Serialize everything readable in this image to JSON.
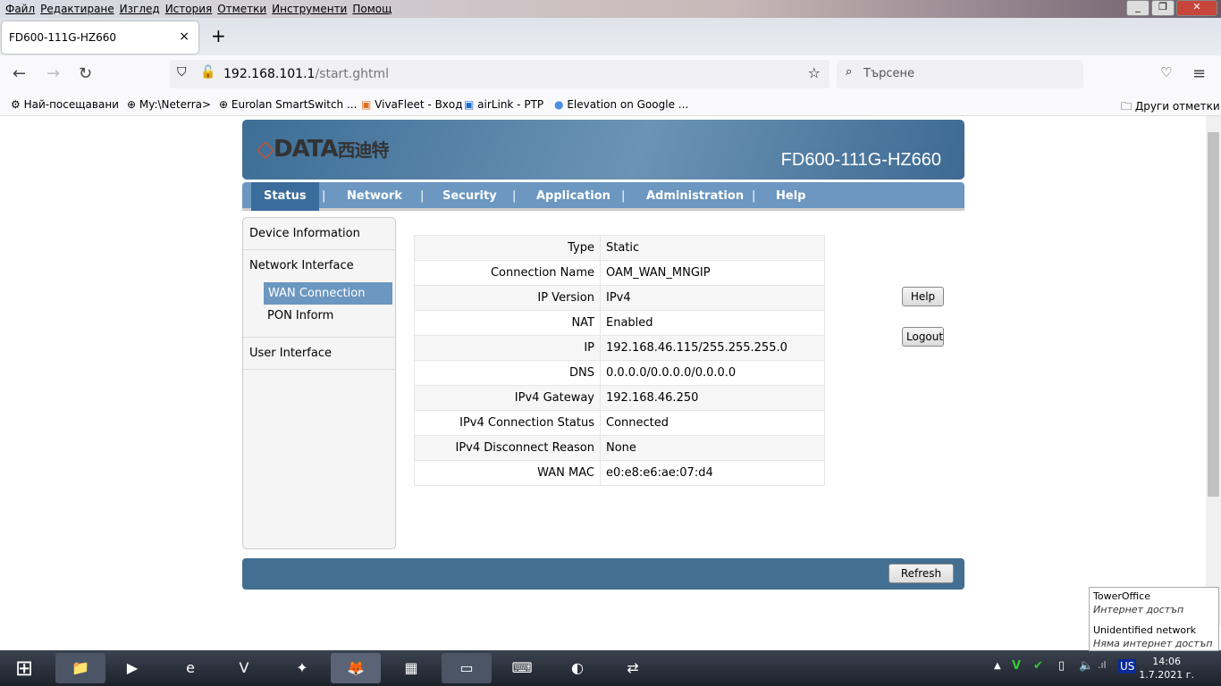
{
  "browser": {
    "menu": [
      "Файл",
      "Редактиране",
      "Изглед",
      "История",
      "Отметки",
      "Инструменти",
      "Помощ"
    ],
    "tab_title": "FD600-111G-HZ660",
    "url_host": "192.168.101.1",
    "url_path": "/start.ghtml",
    "search_placeholder": "Търсене",
    "bookmarks": [
      "Най-посещавани",
      "My:\\Neterra>",
      "Eurolan SmartSwitch ...",
      "VivaFleet - Вход",
      "airLink - PTP",
      "Elevation on Google ..."
    ],
    "other_bookmarks": "Други отметки"
  },
  "header": {
    "logo": "DATA西迪特",
    "model": "FD600-111G-HZ660"
  },
  "menu": [
    "Status",
    "Network",
    "Security",
    "Application",
    "Administration",
    "Help"
  ],
  "sidebar": {
    "device_info": "Device Information",
    "network_interface": "Network Interface",
    "wan_connection": "WAN Connection",
    "pon_inform": "PON Inform",
    "user_interface": "User Interface"
  },
  "details": [
    {
      "k": "Type",
      "v": "Static"
    },
    {
      "k": "Connection Name",
      "v": "OAM_WAN_MNGIP"
    },
    {
      "k": "IP Version",
      "v": "IPv4"
    },
    {
      "k": "NAT",
      "v": "Enabled"
    },
    {
      "k": "IP",
      "v": "192.168.46.115/255.255.255.0"
    },
    {
      "k": "DNS",
      "v": "0.0.0.0/0.0.0.0/0.0.0.0"
    },
    {
      "k": "IPv4 Gateway",
      "v": "192.168.46.250"
    },
    {
      "k": "IPv4 Connection Status",
      "v": "Connected"
    },
    {
      "k": "IPv4 Disconnect Reason",
      "v": "None"
    },
    {
      "k": "WAN MAC",
      "v": "e0:e8:e6:ae:07:d4"
    }
  ],
  "buttons": {
    "help": "Help",
    "logout": "Logout",
    "refresh": "Refresh"
  },
  "tooltip": {
    "net1": "TowerOffice",
    "net1_status": "Интернет достъп",
    "net2": "Unidentified network",
    "net2_status": "Няма интернет достъп"
  },
  "tray": {
    "lang": "US",
    "time": "14:06",
    "date": "1.7.2021 г."
  }
}
